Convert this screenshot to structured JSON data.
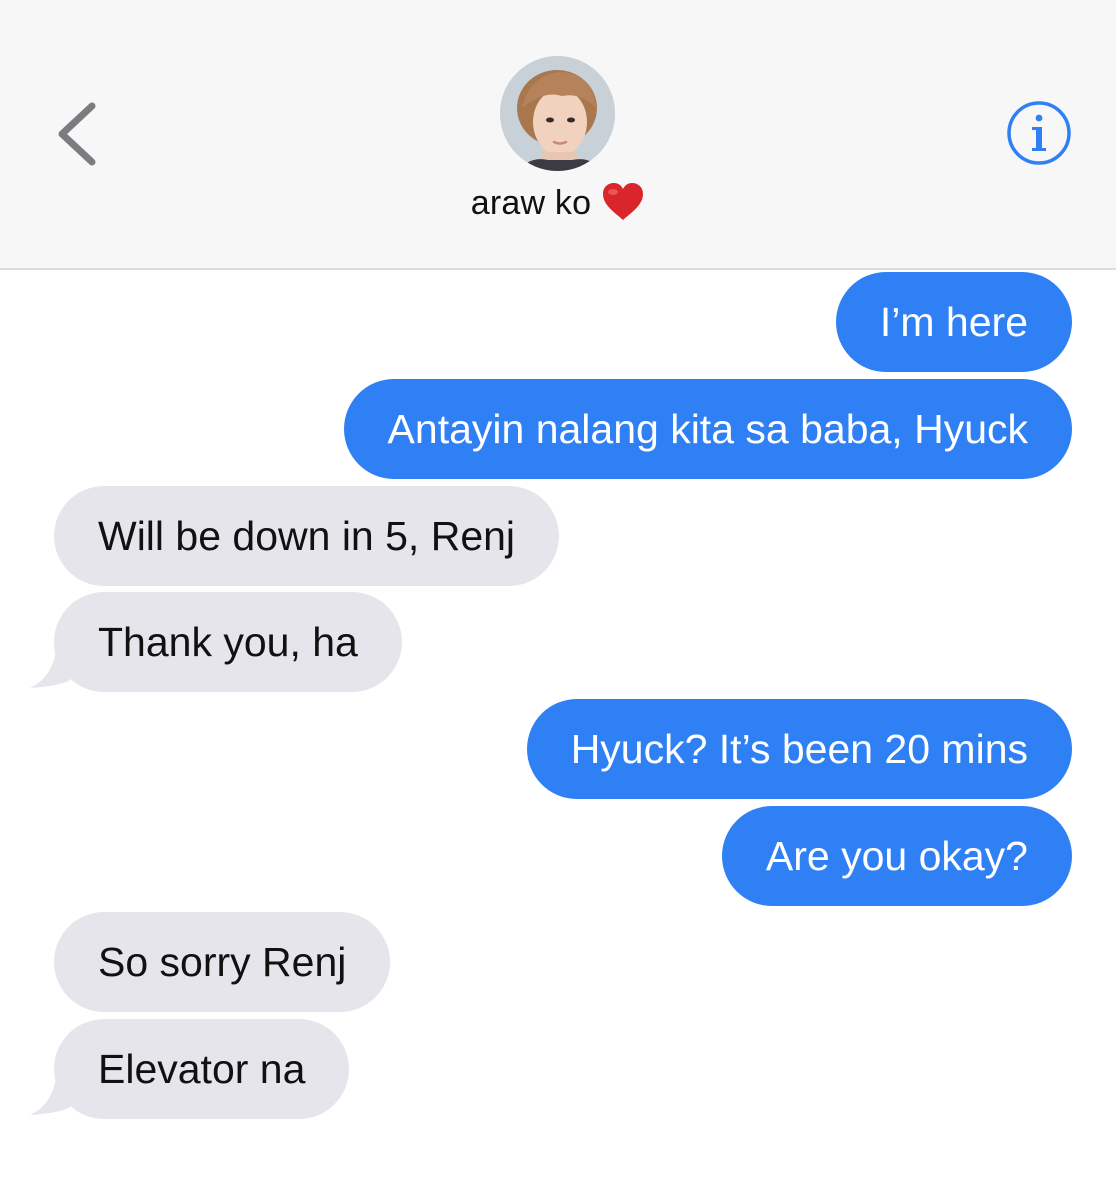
{
  "contact": {
    "name": "araw ko",
    "heart_emoji": "❤️"
  },
  "icons": {
    "back": "chevron-left-icon",
    "info": "info-circle-icon"
  },
  "colors": {
    "accent": "#2f80f5",
    "outgoing_bubble": "#2f80f5",
    "incoming_bubble": "#e6e5eb",
    "header_bg": "#f7f7f7"
  },
  "messages": [
    {
      "direction": "out",
      "text": "I’m here"
    },
    {
      "direction": "out",
      "text": "Antayin nalang kita sa baba, Hyuck"
    },
    {
      "direction": "in",
      "text": "Will be down in 5, Renj"
    },
    {
      "direction": "in",
      "text": "Thank you, ha"
    },
    {
      "direction": "out",
      "text": "Hyuck? It’s been 20 mins"
    },
    {
      "direction": "out",
      "text": "Are you okay?"
    },
    {
      "direction": "in",
      "text": "So sorry Renj"
    },
    {
      "direction": "in",
      "text": "Elevator na"
    }
  ]
}
